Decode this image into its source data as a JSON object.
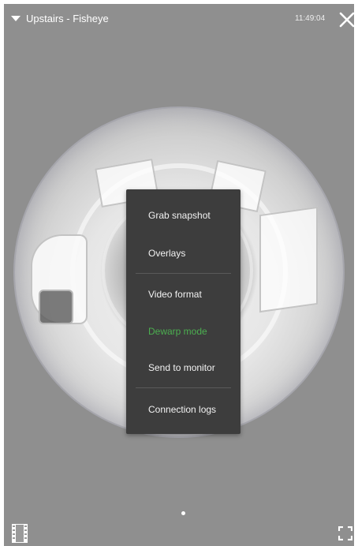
{
  "header": {
    "camera_name": "Upstairs - Fisheye",
    "time": "11:49:04",
    "close_icon": "close-icon",
    "dropdown_icon": "caret-down-icon"
  },
  "menu": {
    "items": [
      {
        "label": "Grab snapshot"
      },
      {
        "label": "Overlays"
      },
      {
        "label": "Video format"
      },
      {
        "label": "Dewarp mode"
      },
      {
        "label": "Send to monitor"
      },
      {
        "label": "Connection logs"
      }
    ],
    "active_item": "Dewarp mode",
    "active_color": "#4caf50"
  },
  "footer": {
    "filmstrip_icon": "filmstrip-icon",
    "fullscreen_icon": "fullscreen-icon",
    "page_indicator": {
      "pages": 1,
      "current": 1
    }
  },
  "colors": {
    "background": "#8f8f8f",
    "menu_background": "#3d3d3d"
  }
}
